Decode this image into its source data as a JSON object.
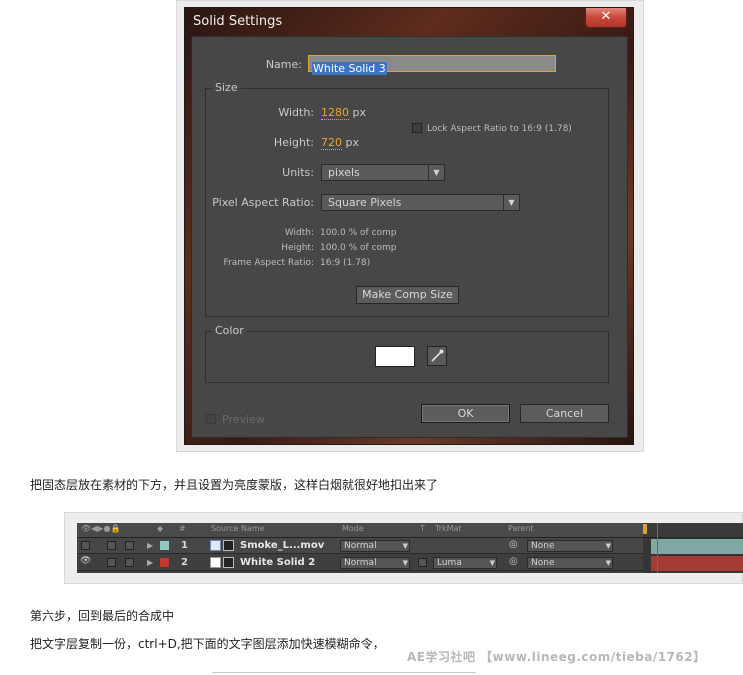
{
  "dialog": {
    "title": "Solid Settings",
    "close": "✕",
    "name_label": "Name:",
    "name_value": "White Solid 3",
    "size_group": "Size",
    "width_label": "Width:",
    "width_value": "1280",
    "width_unit": "px",
    "height_label": "Height:",
    "height_value": "720",
    "height_unit": "px",
    "lock_label": "Lock Aspect Ratio to 16:9 (1.78)",
    "units_label": "Units:",
    "units_value": "pixels",
    "par_label": "Pixel Aspect Ratio:",
    "par_value": "Square Pixels",
    "info_width_label": "Width:",
    "info_width_value": "100.0 % of comp",
    "info_height_label": "Height:",
    "info_height_value": "100.0 % of comp",
    "info_far_label": "Frame Aspect Ratio:",
    "info_far_value": "16:9 (1.78)",
    "make_comp_size": "Make Comp Size",
    "color_group": "Color",
    "color_value": "#ffffff",
    "preview_label": "Preview",
    "ok_label": "OK",
    "cancel_label": "Cancel"
  },
  "text": {
    "para1": "把固态层放在素材的下方，并且设置为亮度蒙版，这样白烟就很好地扣出来了",
    "para2": "第六步，回到最后的合成中",
    "para3": "把文字层复制一份，ctrl+D,把下面的文字图层添加快速模糊命令，"
  },
  "timeline": {
    "columns": {
      "num": "#",
      "source": "Source Name",
      "mode": "Mode",
      "t": "T",
      "trkmat": "TrkMat",
      "parent": "Parent"
    },
    "layers": [
      {
        "num": "1",
        "name": "Smoke_L...mov",
        "mode": "Normal",
        "trkmat": "",
        "parent": "None",
        "color": "#8fc8bf"
      },
      {
        "num": "2",
        "name": "White Solid 2",
        "mode": "Normal",
        "trkmat": "Luma",
        "parent": "None",
        "color": "#c0392b"
      }
    ]
  },
  "watermark": "AE学习社吧 【www.lineeg.com/tieba/1762】"
}
